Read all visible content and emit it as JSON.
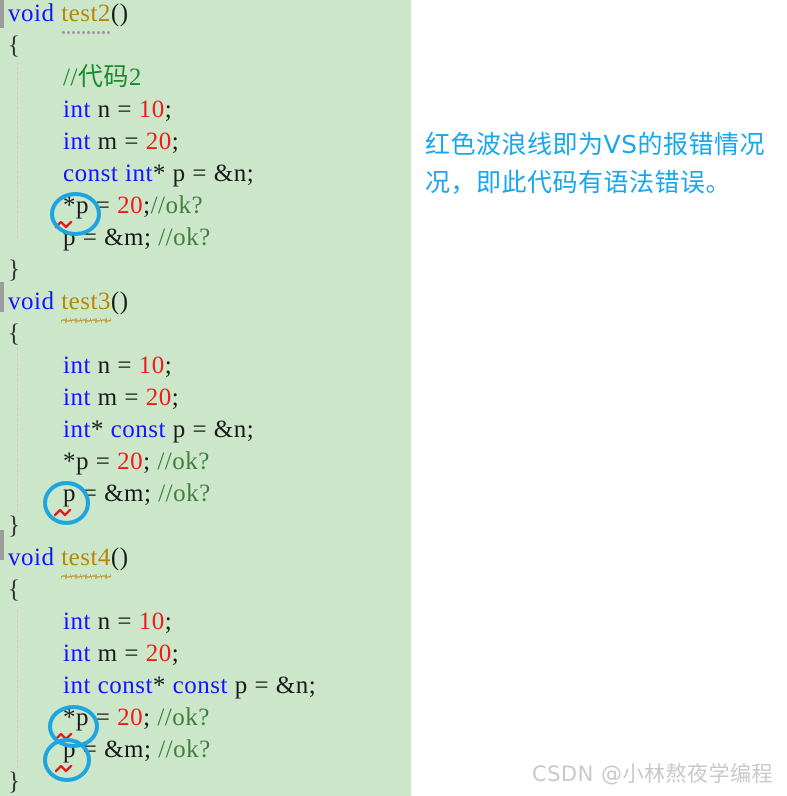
{
  "editor": {
    "background_color": "#cbe6c8",
    "keyword_color": "#1414ff",
    "number_color": "#ef1c1c",
    "comment_color": "#1f8a2d",
    "function_name_color": "#b8860b",
    "error_squiggle_color": "#e01b1b",
    "annotation_circle_color": "#1ca5e0",
    "lines": [
      {
        "indent": 0,
        "tokens": [
          {
            "text": "void ",
            "cls": "kw"
          },
          {
            "text": "test2",
            "cls": "fn dotted"
          },
          {
            "text": "()",
            "cls": "punct"
          }
        ]
      },
      {
        "indent": 0,
        "tokens": [
          {
            "text": "{",
            "cls": "brace"
          }
        ]
      },
      {
        "indent": 1,
        "tokens": [
          {
            "text": "//代码2",
            "cls": "cmt"
          }
        ]
      },
      {
        "indent": 1,
        "tokens": [
          {
            "text": "int",
            "cls": "kw"
          },
          {
            "text": " n = ",
            "cls": "punct"
          },
          {
            "text": "10",
            "cls": "num"
          },
          {
            "text": ";",
            "cls": "punct"
          }
        ]
      },
      {
        "indent": 1,
        "tokens": [
          {
            "text": "int",
            "cls": "kw"
          },
          {
            "text": " m = ",
            "cls": "punct"
          },
          {
            "text": "20",
            "cls": "num"
          },
          {
            "text": ";",
            "cls": "punct"
          }
        ]
      },
      {
        "indent": 1,
        "tokens": [
          {
            "text": "const int",
            "cls": "kw"
          },
          {
            "text": "* p = &n;",
            "cls": "punct"
          }
        ]
      },
      {
        "indent": 1,
        "tokens": [
          {
            "text": "*p = ",
            "cls": "punct"
          },
          {
            "text": "20",
            "cls": "num"
          },
          {
            "text": ";",
            "cls": "punct"
          },
          {
            "text": "//ok?",
            "cls": "cmt2"
          }
        ]
      },
      {
        "indent": 1,
        "tokens": [
          {
            "text": "p = &m; ",
            "cls": "punct"
          },
          {
            "text": "//ok?",
            "cls": "cmt2"
          }
        ]
      },
      {
        "indent": 0,
        "tokens": [
          {
            "text": "}",
            "cls": "brace"
          }
        ]
      },
      {
        "indent": 0,
        "tokens": [
          {
            "text": "void ",
            "cls": "kw"
          },
          {
            "text": "test3",
            "cls": "fn wavy"
          },
          {
            "text": "()",
            "cls": "punct"
          }
        ]
      },
      {
        "indent": 0,
        "tokens": [
          {
            "text": "{",
            "cls": "brace"
          }
        ]
      },
      {
        "indent": 1,
        "tokens": [
          {
            "text": "int",
            "cls": "kw"
          },
          {
            "text": " n = ",
            "cls": "punct"
          },
          {
            "text": "10",
            "cls": "num"
          },
          {
            "text": ";",
            "cls": "punct"
          }
        ]
      },
      {
        "indent": 1,
        "tokens": [
          {
            "text": "int",
            "cls": "kw"
          },
          {
            "text": " m = ",
            "cls": "punct"
          },
          {
            "text": "20",
            "cls": "num"
          },
          {
            "text": ";",
            "cls": "punct"
          }
        ]
      },
      {
        "indent": 1,
        "tokens": [
          {
            "text": "int",
            "cls": "kw"
          },
          {
            "text": "* ",
            "cls": "punct"
          },
          {
            "text": "const",
            "cls": "kw"
          },
          {
            "text": " p = &n;",
            "cls": "punct"
          }
        ]
      },
      {
        "indent": 1,
        "tokens": [
          {
            "text": "*p = ",
            "cls": "punct"
          },
          {
            "text": "20",
            "cls": "num"
          },
          {
            "text": "; ",
            "cls": "punct"
          },
          {
            "text": "//ok?",
            "cls": "cmt2"
          }
        ]
      },
      {
        "indent": 1,
        "tokens": [
          {
            "text": "p = &m; ",
            "cls": "punct"
          },
          {
            "text": "//ok?",
            "cls": "cmt2"
          }
        ]
      },
      {
        "indent": 0,
        "tokens": [
          {
            "text": "}",
            "cls": "brace"
          }
        ]
      },
      {
        "indent": 0,
        "tokens": [
          {
            "text": "void ",
            "cls": "kw"
          },
          {
            "text": "test4",
            "cls": "fn wavy"
          },
          {
            "text": "()",
            "cls": "punct"
          }
        ]
      },
      {
        "indent": 0,
        "tokens": [
          {
            "text": "{",
            "cls": "brace"
          }
        ]
      },
      {
        "indent": 1,
        "tokens": [
          {
            "text": "int",
            "cls": "kw"
          },
          {
            "text": " n = ",
            "cls": "punct"
          },
          {
            "text": "10",
            "cls": "num"
          },
          {
            "text": ";",
            "cls": "punct"
          }
        ]
      },
      {
        "indent": 1,
        "tokens": [
          {
            "text": "int",
            "cls": "kw"
          },
          {
            "text": " m = ",
            "cls": "punct"
          },
          {
            "text": "20",
            "cls": "num"
          },
          {
            "text": ";",
            "cls": "punct"
          }
        ]
      },
      {
        "indent": 1,
        "tokens": [
          {
            "text": "int const",
            "cls": "kw"
          },
          {
            "text": "* ",
            "cls": "punct"
          },
          {
            "text": "const",
            "cls": "kw"
          },
          {
            "text": " p = &n;",
            "cls": "punct"
          }
        ]
      },
      {
        "indent": 1,
        "tokens": [
          {
            "text": "*p = ",
            "cls": "punct"
          },
          {
            "text": "20",
            "cls": "num"
          },
          {
            "text": "; ",
            "cls": "punct"
          },
          {
            "text": "//ok?",
            "cls": "cmt2"
          }
        ]
      },
      {
        "indent": 1,
        "tokens": [
          {
            "text": "p = &m; ",
            "cls": "punct"
          },
          {
            "text": "//ok?",
            "cls": "cmt2"
          }
        ]
      },
      {
        "indent": 0,
        "tokens": [
          {
            "text": "}",
            "cls": "brace"
          }
        ]
      }
    ]
  },
  "annotation": {
    "color": "#18a6ef",
    "line1": "红色波浪线即为VS的报错情况",
    "line2": "况，即此代码有语法错误。"
  },
  "watermark": {
    "text": "CSDN @小林熬夜学编程"
  }
}
